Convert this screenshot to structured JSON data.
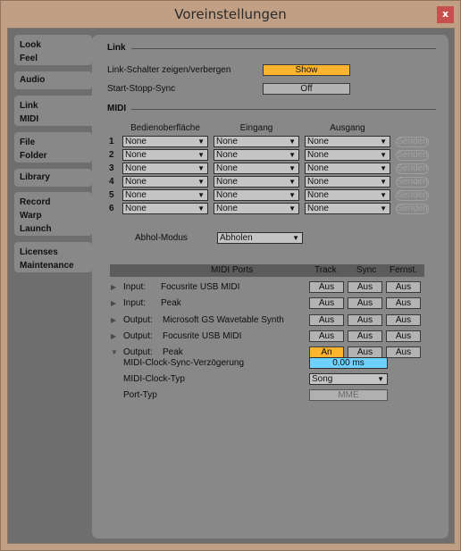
{
  "window": {
    "title": "Voreinstellungen",
    "close_label": "x"
  },
  "sidebar": {
    "items": [
      {
        "lines": [
          "Look",
          "Feel"
        ]
      },
      {
        "lines": [
          "Audio"
        ]
      },
      {
        "lines": [
          "Link",
          "MIDI"
        ],
        "active": true
      },
      {
        "lines": [
          "File",
          "Folder"
        ]
      },
      {
        "lines": [
          "Library"
        ]
      },
      {
        "lines": [
          "Record",
          "Warp",
          "Launch"
        ]
      },
      {
        "lines": [
          "Licenses",
          "Maintenance"
        ]
      }
    ]
  },
  "link": {
    "section_title": "Link",
    "show_switch_label": "Link-Schalter zeigen/verbergen",
    "show_switch_value": "Show",
    "start_stop_label": "Start-Stopp-Sync",
    "start_stop_value": "Off"
  },
  "midi": {
    "section_title": "MIDI",
    "columns": [
      "Bedienoberfläche",
      "Eingang",
      "Ausgang"
    ],
    "rows": [
      {
        "num": "1",
        "surface": "None",
        "input": "None",
        "output": "None",
        "send": "Senden"
      },
      {
        "num": "2",
        "surface": "None",
        "input": "None",
        "output": "None",
        "send": "Senden"
      },
      {
        "num": "3",
        "surface": "None",
        "input": "None",
        "output": "None",
        "send": "Senden"
      },
      {
        "num": "4",
        "surface": "None",
        "input": "None",
        "output": "None",
        "send": "Senden"
      },
      {
        "num": "5",
        "surface": "None",
        "input": "None",
        "output": "None",
        "send": "Senden"
      },
      {
        "num": "6",
        "surface": "None",
        "input": "None",
        "output": "None",
        "send": "Senden"
      }
    ],
    "takeover_label": "Abhol-Modus",
    "takeover_value": "Abholen"
  },
  "ports": {
    "header": {
      "name": "MIDI Ports",
      "track": "Track",
      "sync": "Sync",
      "remote": "Fernst."
    },
    "rows": [
      {
        "type": "Input:",
        "name": "Focusrite USB MIDI",
        "track": "Aus",
        "sync": "Aus",
        "remote": "Aus",
        "expanded": false,
        "track_on": false
      },
      {
        "type": "Input:",
        "name": "Peak",
        "track": "Aus",
        "sync": "Aus",
        "remote": "Aus",
        "expanded": false,
        "track_on": false
      },
      {
        "type": "Output:",
        "name": "Microsoft GS Wavetable Synth",
        "track": "Aus",
        "sync": "Aus",
        "remote": "Aus",
        "expanded": false,
        "track_on": false
      },
      {
        "type": "Output:",
        "name": "Focusrite USB MIDI",
        "track": "Aus",
        "sync": "Aus",
        "remote": "Aus",
        "expanded": false,
        "track_on": false
      },
      {
        "type": "Output:",
        "name": "Peak",
        "track": "An",
        "sync": "Aus",
        "remote": "Aus",
        "expanded": true,
        "track_on": true
      }
    ],
    "details": {
      "clock_delay_label": "MIDI-Clock-Sync-Verzögerung",
      "clock_delay_value": "0.00 ms",
      "clock_type_label": "MIDI-Clock-Typ",
      "clock_type_value": "Song",
      "port_type_label": "Port-Typ",
      "port_type_value": "MME"
    }
  },
  "colors": {
    "accent_on": "#ffb42e",
    "value_field": "#6fd1ff",
    "close": "#c7504f"
  }
}
